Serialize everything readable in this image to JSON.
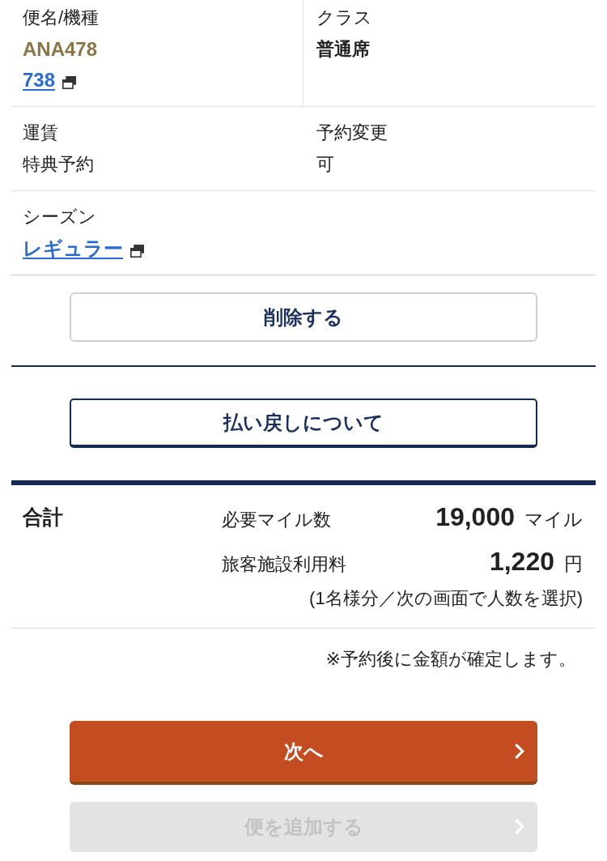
{
  "details": [
    {
      "divider": true,
      "cells": [
        {
          "label": "便名/機種",
          "values": [
            {
              "kind": "flight",
              "text": "ANA478"
            },
            {
              "kind": "link",
              "text": "738"
            }
          ]
        },
        {
          "label": "クラス",
          "values": [
            {
              "kind": "bold",
              "text": "普通席"
            }
          ]
        }
      ]
    },
    {
      "divider": false,
      "cells": [
        {
          "label": "運賃",
          "values": [
            {
              "kind": "plain",
              "text": "特典予約"
            }
          ]
        },
        {
          "label": "予約変更",
          "values": [
            {
              "kind": "plain",
              "text": "可"
            }
          ]
        }
      ]
    },
    {
      "divider": false,
      "cells": [
        {
          "label": "シーズン",
          "values": [
            {
              "kind": "link",
              "text": "レギュラー"
            }
          ]
        }
      ]
    }
  ],
  "delete_button": {
    "label": "削除する"
  },
  "refund_button": {
    "label": "払い戻しについて"
  },
  "total": {
    "heading": "合計",
    "lines": [
      {
        "label": "必要マイル数",
        "amount": "19,000",
        "unit": "マイル"
      },
      {
        "label": "旅客施設利用料",
        "amount": "1,220",
        "unit": "円"
      }
    ],
    "note": "(1名様分／次の画面で人数を選択)"
  },
  "notice": "※予約後に金額が確定します。",
  "actions": [
    {
      "label": "次へ",
      "disabled": false
    },
    {
      "label": "便を追加する",
      "disabled": true
    }
  ]
}
